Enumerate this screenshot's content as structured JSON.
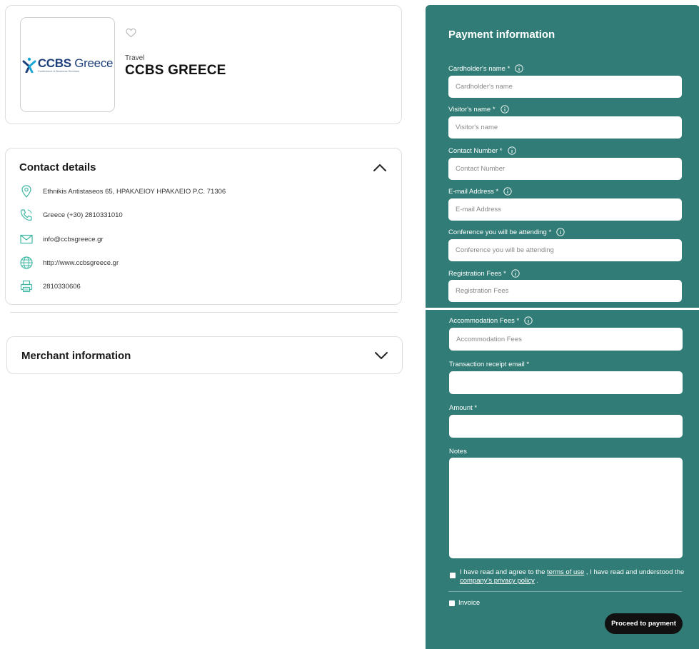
{
  "merchant": {
    "logo_text_bold": "CCBS",
    "logo_text": " Greece",
    "logo_subtitle": "Conference & Business Services",
    "category": "Travel",
    "name": "CCBS GREECE"
  },
  "contact": {
    "title": "Contact details",
    "items": [
      {
        "icon": "location-pin-icon",
        "text": "Ethnikis Antistaseos 65, ΗΡΑΚΛΕΙΟΥ ΗΡΑΚΛΕΙΟ P.C. 71306"
      },
      {
        "icon": "phone-icon",
        "text": "Greece (+30) 2810331010"
      },
      {
        "icon": "mail-icon",
        "text": "info@ccbsgreece.gr"
      },
      {
        "icon": "globe-icon",
        "text": "http://www.ccbsgreece.gr"
      },
      {
        "icon": "printer-icon",
        "text": "2810330606"
      }
    ]
  },
  "merchant_info": {
    "title": "Merchant information"
  },
  "payment": {
    "title": "Payment information",
    "fields": [
      {
        "label": "Cardholder's name *",
        "placeholder": "Cardholder's name"
      },
      {
        "label": "Visitor's name *",
        "placeholder": "Visitor's name"
      },
      {
        "label": "Contact Number *",
        "placeholder": "Contact Number"
      },
      {
        "label": "E-mail Address *",
        "placeholder": "E-mail Address"
      },
      {
        "label": "Conference you will be attending *",
        "placeholder": "Conference you will be attending"
      },
      {
        "label": "Registration Fees *",
        "placeholder": "Registration Fees"
      },
      {
        "label": "Accommodation Fees *",
        "placeholder": "Accommodation Fees"
      }
    ],
    "receipt_email_label": "Transaction receipt email *",
    "amount_label": "Amount *",
    "notes_label": "Notes",
    "terms_prefix": "I have read and agree to the ",
    "terms_link": "terms of use",
    "terms_middle": " , I have read and understood the ",
    "privacy_link": "company's privacy policy",
    "terms_suffix": " .",
    "invoice_label": "Invoice",
    "submit_label": "Proceed to payment"
  },
  "colors": {
    "panel": "#317c76",
    "icon_accent": "#3fb8a4",
    "button": "#111111"
  }
}
